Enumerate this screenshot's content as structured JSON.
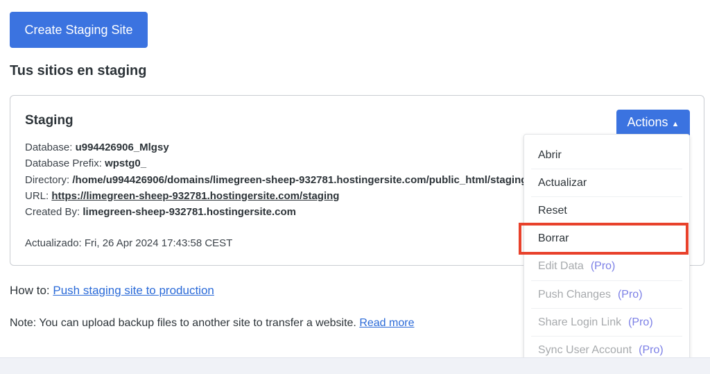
{
  "create_button": "Create Staging Site",
  "section_title": "Tus sitios en staging",
  "site": {
    "name": "Staging",
    "database_label": "Database:",
    "database": "u994426906_Mlgsy",
    "prefix_label": "Database Prefix:",
    "prefix": "wpstg0_",
    "directory_label": "Directory:",
    "directory": "/home/u994426906/domains/limegreen-sheep-932781.hostingersite.com/public_html/staging",
    "url_label": "URL:",
    "url": "https://limegreen-sheep-932781.hostingersite.com/staging",
    "created_label": "Created By:",
    "created_by": "limegreen-sheep-932781.hostingersite.com",
    "updated": "Actualizado: Fri, 26 Apr 2024 17:43:58 CEST"
  },
  "actions": {
    "label": "Actions",
    "items": [
      {
        "label": "Abrir"
      },
      {
        "label": "Actualizar"
      },
      {
        "label": "Reset"
      },
      {
        "label": "Borrar"
      },
      {
        "label": "Edit Data",
        "badge": "(Pro)"
      },
      {
        "label": "Push Changes",
        "badge": "(Pro)"
      },
      {
        "label": "Share Login Link",
        "badge": "(Pro)"
      },
      {
        "label": "Sync User Account",
        "badge": "(Pro)"
      }
    ]
  },
  "howto": {
    "prefix": "How to:",
    "link": "Push staging site to production"
  },
  "note": {
    "text": "Note: You can upload backup files to another site to transfer a website.",
    "link": "Read more"
  },
  "colors": {
    "primary": "#3b73e0",
    "highlight": "#e8412b",
    "pro": "#7b7fe6"
  }
}
